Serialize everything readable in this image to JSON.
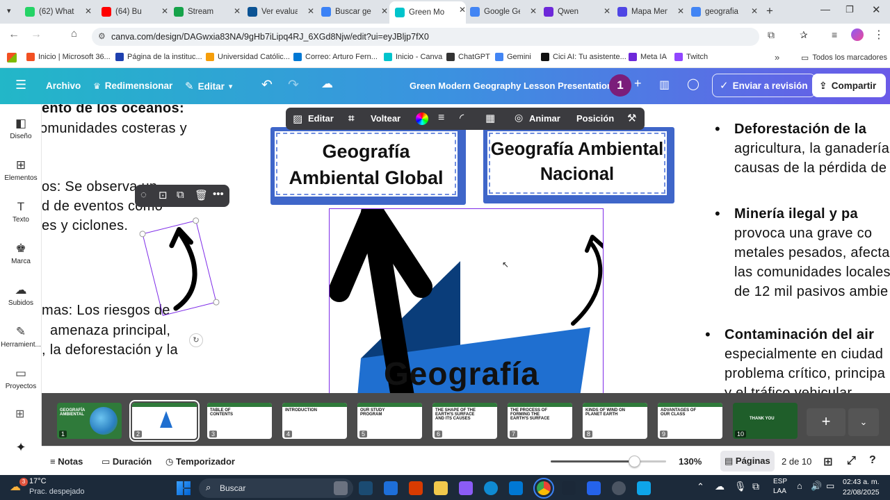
{
  "browser": {
    "tabs": [
      {
        "label": "(62) What",
        "color": "#25d366"
      },
      {
        "label": "(64) Bu",
        "color": "#ff0000"
      },
      {
        "label": "Stream",
        "color": "#16a34a"
      },
      {
        "label": "Ver evalua",
        "color": "#0b5394"
      },
      {
        "label": "Buscar ge",
        "color": "#3b82f6"
      },
      {
        "label": "Green Mo",
        "color": "#00c4cc"
      },
      {
        "label": "Google Ge",
        "color": "#4285f4"
      },
      {
        "label": "Qwen",
        "color": "#6d28d9"
      },
      {
        "label": "Mapa Men",
        "color": "#4f46e5"
      },
      {
        "label": "geografia",
        "color": "#4285f4"
      }
    ],
    "url": "canva.com/design/DAGwxia83NA/9gHb7iLipq4RJ_6XGd8Njw/edit?ui=eyJBljp7fX0",
    "bookmarks": [
      {
        "label": "Inicio | Microsoft 36...",
        "color": "#f25022"
      },
      {
        "label": "Página de la instituc...",
        "color": "#1e40af"
      },
      {
        "label": "Universidad Católic...",
        "color": "#f59e0b"
      },
      {
        "label": "Correo: Arturo Fern...",
        "color": "#0078d4"
      },
      {
        "label": "Inicio - Canva",
        "color": "#00c4cc"
      },
      {
        "label": "ChatGPT",
        "color": "#333333"
      },
      {
        "label": "Gemini",
        "color": "#4285f4"
      },
      {
        "label": "Cici AI: Tu asistente...",
        "color": "#111111"
      },
      {
        "label": "Meta IA",
        "color": "#6d28d9"
      },
      {
        "label": "Twitch",
        "color": "#9146ff"
      }
    ],
    "all_bookmarks": "Todos los marcadores"
  },
  "canva": {
    "header": {
      "file": "Archivo",
      "resize": "Redimensionar",
      "edit": "Editar",
      "title": "Green Modern Geography Lesson Presentation",
      "collab_count": "1",
      "send_review": "Enviar a revisión",
      "share": "Compartir"
    },
    "sidebar": [
      {
        "label": "Diseño",
        "icon": "layout-icon"
      },
      {
        "label": "Elementos",
        "icon": "elements-icon"
      },
      {
        "label": "Texto",
        "icon": "text-icon"
      },
      {
        "label": "Marca",
        "icon": "brand-icon"
      },
      {
        "label": "Subidos",
        "icon": "upload-icon"
      },
      {
        "label": "Herramient...",
        "icon": "tools-icon"
      },
      {
        "label": "Proyectos",
        "icon": "folder-icon"
      }
    ],
    "context_toolbar": {
      "edit": "Editar",
      "flip": "Voltear",
      "animate": "Animar",
      "position": "Posición"
    },
    "slide": {
      "left_lines": [
        "ento de los océanos:",
        "omunidades costeras y",
        "os: Se observa un",
        "d de eventos como",
        "es y ciclones.",
        "mas: Los riesgos de",
        "amenaza principal,",
        ", la deforestación y la"
      ],
      "card_global": "Geografía Ambiental Global",
      "card_nacional": "Geografía Ambiental Nacional",
      "logo_text": "Geografía",
      "right_items": [
        {
          "head": "Deforestación de la",
          "lines": [
            "agricultura, la ganadería",
            "causas de la pérdida de"
          ]
        },
        {
          "head": "Minería ilegal y pa",
          "lines": [
            "provoca una grave co",
            "metales pesados, afecta",
            "las comunidades locales",
            "de 12 mil pasivos ambie"
          ]
        },
        {
          "head": "Contaminación del air",
          "lines": [
            "especialmente en ciudad",
            "problema crítico, principa",
            "y el tráfico vehicular"
          ]
        }
      ]
    },
    "pages": [
      {
        "num": "1",
        "title": "GEOGRAFÍA AMBIENTAL",
        "bg": "#2f7a3a"
      },
      {
        "num": "2",
        "title": "",
        "bg": "#ffffff"
      },
      {
        "num": "3",
        "title": "TABLE OF CONTENTS",
        "bg": "#ffffff"
      },
      {
        "num": "4",
        "title": "INTRODUCTION",
        "bg": "#ffffff"
      },
      {
        "num": "5",
        "title": "OUR STUDY PROGRAM",
        "bg": "#ffffff"
      },
      {
        "num": "6",
        "title": "THE SHAPE OF THE EARTH'S SURFACE AND ITS CAUSES",
        "bg": "#ffffff"
      },
      {
        "num": "7",
        "title": "THE PROCESS OF FORMING THE EARTH'S SURFACE",
        "bg": "#ffffff"
      },
      {
        "num": "8",
        "title": "KINDS OF WIND ON PLANET EARTH",
        "bg": "#ffffff"
      },
      {
        "num": "9",
        "title": "ADVANTAGES OF OUR CLASS",
        "bg": "#ffffff"
      },
      {
        "num": "10",
        "title": "THANK YOU",
        "bg": "#1f5e2a"
      }
    ],
    "footer": {
      "notes": "Notas",
      "duration": "Duración",
      "timer": "Temporizador",
      "zoom": "130%",
      "zoom_fraction": 0.72,
      "pages_label": "Páginas",
      "page_counter": "2 de 10"
    }
  },
  "taskbar": {
    "temperature": "17°C",
    "weather": "Prac. despejado",
    "weather_badge": "3",
    "search": "Buscar",
    "lang_top": "ESP",
    "lang_bottom": "LAA",
    "time": "02:43 a. m.",
    "date": "22/08/2025"
  }
}
